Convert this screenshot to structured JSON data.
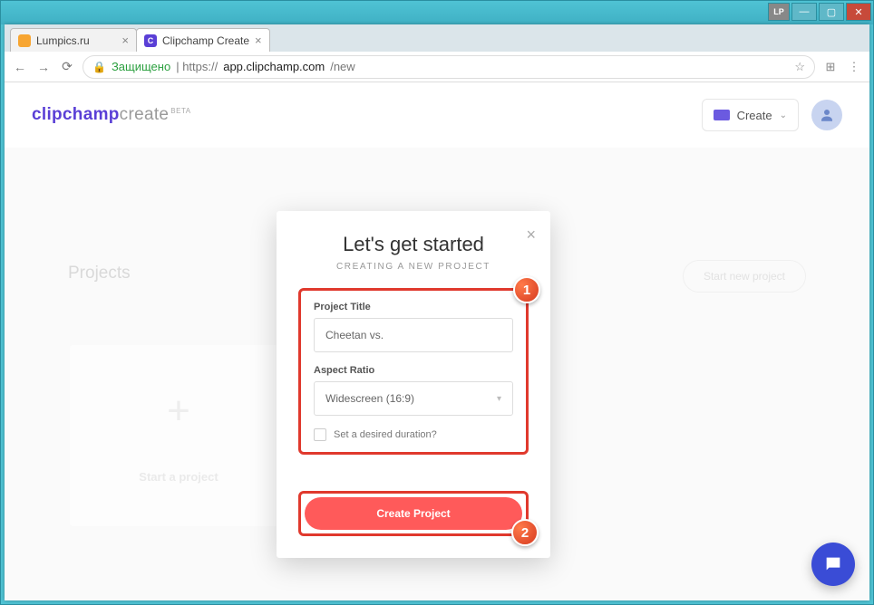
{
  "titlebar": {
    "lp_label": "LP"
  },
  "tabs": [
    {
      "title": "Lumpics.ru"
    },
    {
      "title": "Clipchamp Create",
      "fav_letter": "C"
    }
  ],
  "addressbar": {
    "secure_label": "Защищено",
    "url_prefix": "https://",
    "url_host": "app.clipchamp.com",
    "url_path": "/new"
  },
  "logo": {
    "part1": "clipchamp",
    "part2": "create",
    "beta": "BETA"
  },
  "topbar": {
    "create_label": "Create"
  },
  "sections": {
    "projects": "Projects",
    "start_new": "Start new project",
    "start_project": "Start a project"
  },
  "modal": {
    "title": "Let's get started",
    "subtitle": "CREATING A NEW PROJECT",
    "project_title_label": "Project Title",
    "project_title_value": "Cheetan vs.",
    "aspect_label": "Aspect Ratio",
    "aspect_value": "Widescreen (16:9)",
    "duration_label": "Set a desired duration?",
    "create_button": "Create Project",
    "badge1": "1",
    "badge2": "2"
  }
}
